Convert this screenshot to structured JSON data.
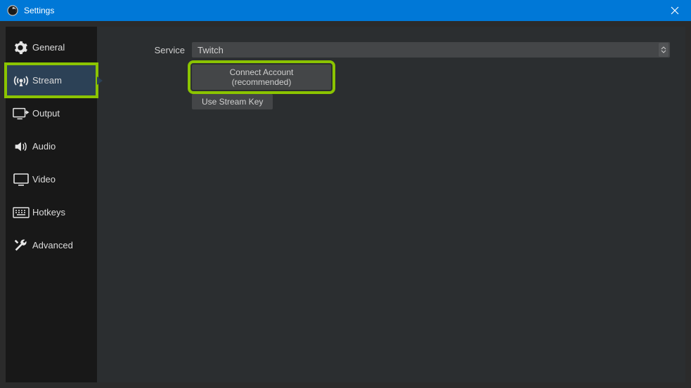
{
  "titlebar": {
    "title": "Settings"
  },
  "sidebar": {
    "items": [
      {
        "label": "General",
        "icon": "gear-icon",
        "active": false,
        "highlight": false
      },
      {
        "label": "Stream",
        "icon": "broadcast-icon",
        "active": true,
        "highlight": true
      },
      {
        "label": "Output",
        "icon": "output-icon",
        "active": false,
        "highlight": false
      },
      {
        "label": "Audio",
        "icon": "speaker-icon",
        "active": false,
        "highlight": false
      },
      {
        "label": "Video",
        "icon": "monitor-icon",
        "active": false,
        "highlight": false
      },
      {
        "label": "Hotkeys",
        "icon": "keyboard-icon",
        "active": false,
        "highlight": false
      },
      {
        "label": "Advanced",
        "icon": "wrench-icon",
        "active": false,
        "highlight": false
      }
    ]
  },
  "content": {
    "service_label": "Service",
    "service_value": "Twitch",
    "connect_label": "Connect Account (recommended)",
    "streamkey_label": "Use Stream Key",
    "connect_highlight": true
  }
}
